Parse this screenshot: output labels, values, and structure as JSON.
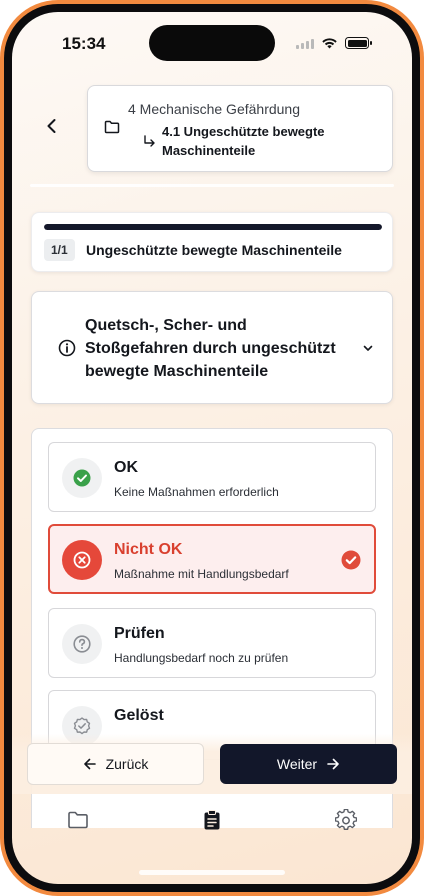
{
  "status_bar": {
    "time": "15:34"
  },
  "breadcrumb": {
    "parent": "4 Mechanische Gefährdung",
    "current": "4.1 Ungeschützte bewegte Maschinenteile"
  },
  "progress": {
    "fraction": 1.0,
    "badge": "1/1",
    "title": "Ungeschützte bewegte Maschinenteile"
  },
  "question": {
    "text": "Quetsch-, Scher- und Stoßgefahren durch ungeschützt bewegte Maschinenteile",
    "icon": "info-icon"
  },
  "options": [
    {
      "title": "OK",
      "description": "Keine Maßnahmen erforderlich",
      "icon": "check-circle-icon",
      "selected": false
    },
    {
      "title": "Nicht OK",
      "description": "Maßnahme mit Handlungsbedarf",
      "icon": "x-circle-icon",
      "selected": true
    },
    {
      "title": "Prüfen",
      "description": "Handlungsbedarf noch zu prüfen",
      "icon": "question-circle-icon",
      "selected": false
    },
    {
      "title": "Gelöst",
      "description": "",
      "icon": "badge-check-icon",
      "selected": false
    }
  ],
  "footer": {
    "back_label": "Zurück",
    "next_label": "Weiter"
  },
  "tabs": [
    {
      "name": "folder-icon"
    },
    {
      "name": "clipboard-icon"
    },
    {
      "name": "gear-icon"
    }
  ],
  "colors": {
    "accent_dark": "#12172a",
    "danger": "#e04b3a",
    "success": "#3aa14a",
    "frame": "#f28a3f"
  }
}
